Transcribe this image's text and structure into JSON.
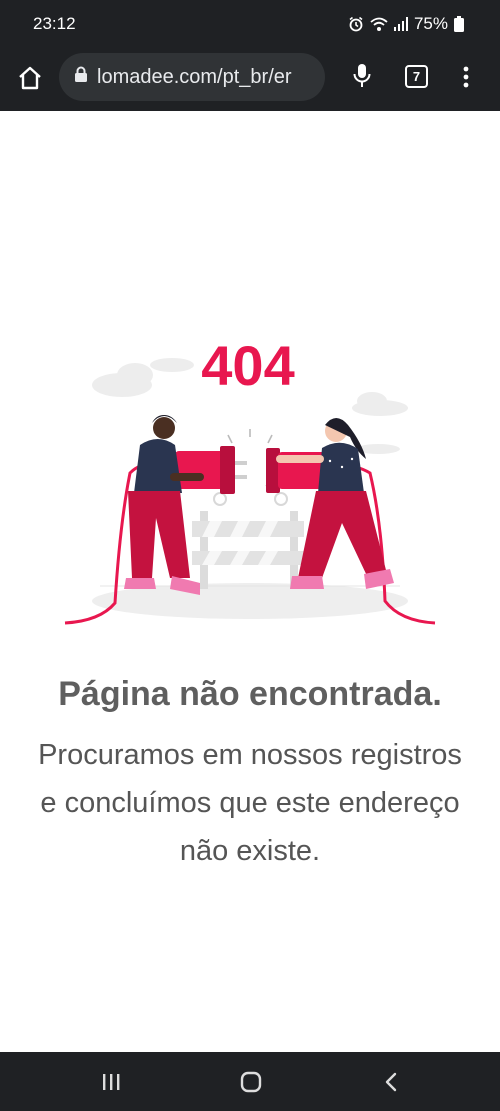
{
  "status_bar": {
    "time": "23:12",
    "battery": "75%",
    "icons": [
      "alarm-icon",
      "wifi-icon",
      "signal-icon",
      "battery-icon"
    ]
  },
  "browser": {
    "url": "lomadee.com/pt_br/er",
    "tab_count": "7",
    "icons": [
      "home-icon",
      "lock-icon",
      "mic-icon",
      "tabs-icon",
      "more-vert-icon"
    ]
  },
  "page": {
    "error_code": "404",
    "title": "Página não encontrada.",
    "message_lines": [
      "Procuramos em nossos registros",
      "e concluímos que este endereço",
      "não existe."
    ],
    "accent_color": "#e8174f"
  },
  "nav_bar": {
    "icons": [
      "recents-icon",
      "home-circle-icon",
      "back-icon"
    ]
  }
}
